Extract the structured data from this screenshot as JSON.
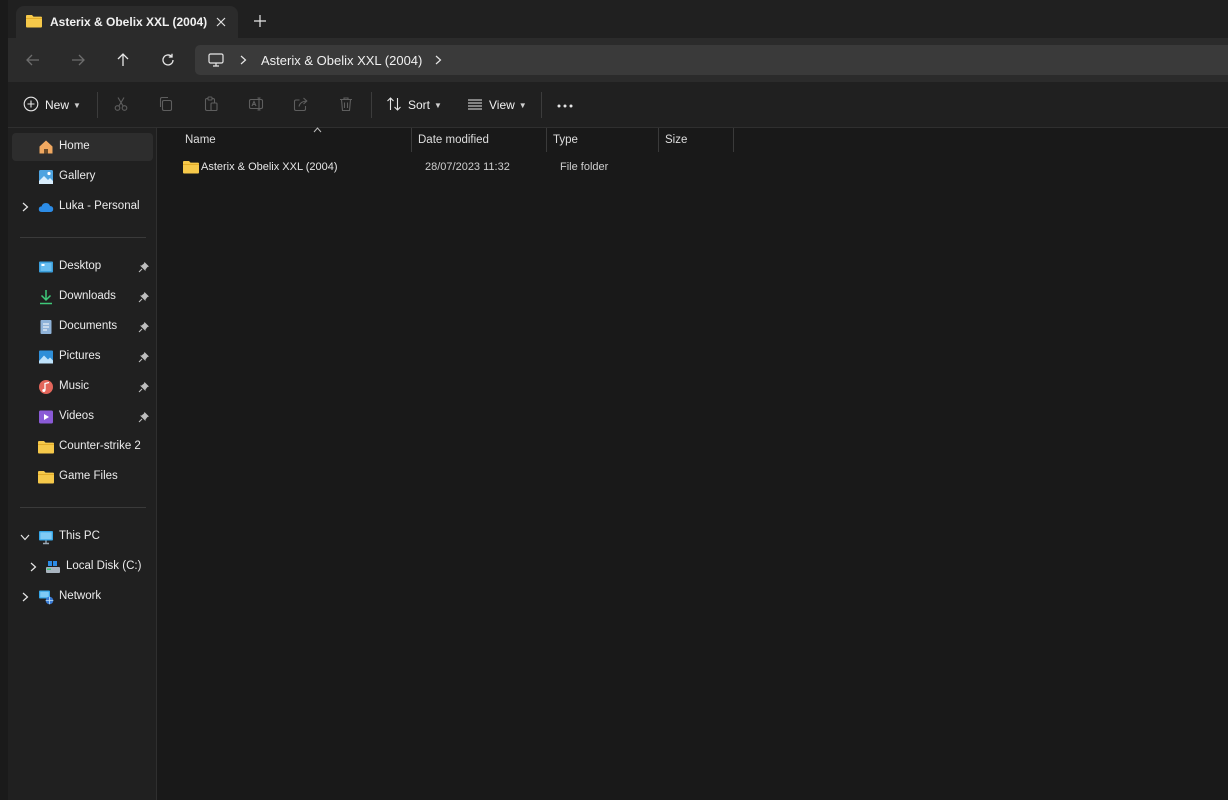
{
  "window": {
    "tab": {
      "title": "Asterix & Obelix XXL (2004)",
      "icon": "folder-icon"
    },
    "new_tab_icon": "plus-icon"
  },
  "navigation": {
    "back_icon": "arrow-left-icon",
    "forward_icon": "arrow-right-icon",
    "up_icon": "arrow-up-icon",
    "refresh_icon": "refresh-icon",
    "address": {
      "root_icon": "monitor-icon",
      "crumbs": [
        "Asterix & Obelix XXL (2004)"
      ]
    }
  },
  "toolbar": {
    "new_label": "New",
    "cut_icon": "scissors-icon",
    "copy_icon": "copy-icon",
    "paste_icon": "paste-icon",
    "rename_icon": "rename-icon",
    "share_icon": "share-icon",
    "delete_icon": "trash-icon",
    "sort_label": "Sort",
    "view_label": "View",
    "more_icon": "ellipsis-icon"
  },
  "sidebar": {
    "quick": [
      {
        "label": "Home",
        "icon": "home-icon",
        "selected": true
      },
      {
        "label": "Gallery",
        "icon": "gallery-icon"
      },
      {
        "label": "Luka - Personal",
        "icon": "cloud-icon",
        "expandable": true
      }
    ],
    "pinned": [
      {
        "label": "Desktop",
        "icon": "desktop-icon",
        "pinned": true
      },
      {
        "label": "Downloads",
        "icon": "download-icon",
        "pinned": true
      },
      {
        "label": "Documents",
        "icon": "document-icon",
        "pinned": true
      },
      {
        "label": "Pictures",
        "icon": "pictures-icon",
        "pinned": true
      },
      {
        "label": "Music",
        "icon": "music-icon",
        "pinned": true
      },
      {
        "label": "Videos",
        "icon": "video-icon",
        "pinned": true
      },
      {
        "label": "Counter-strike 2",
        "icon": "folder-icon"
      },
      {
        "label": "Game Files",
        "icon": "folder-icon"
      }
    ],
    "devices": [
      {
        "label": "This PC",
        "icon": "pc-icon",
        "expanded": true
      },
      {
        "label": "Local Disk (C:)",
        "icon": "disk-icon",
        "expandable": true
      },
      {
        "label": "Network",
        "icon": "network-icon",
        "expandable": true
      }
    ]
  },
  "file_list": {
    "columns": [
      "Name",
      "Date modified",
      "Type",
      "Size"
    ],
    "rows": [
      {
        "name": "Asterix & Obelix XXL (2004)",
        "date_modified": "28/07/2023 11:32",
        "type": "File folder",
        "size": ""
      }
    ]
  },
  "colors": {
    "background": "#202020",
    "content_background": "#191919",
    "folder_yellow": "#f6c94a",
    "selected": "#2d2d2d"
  }
}
